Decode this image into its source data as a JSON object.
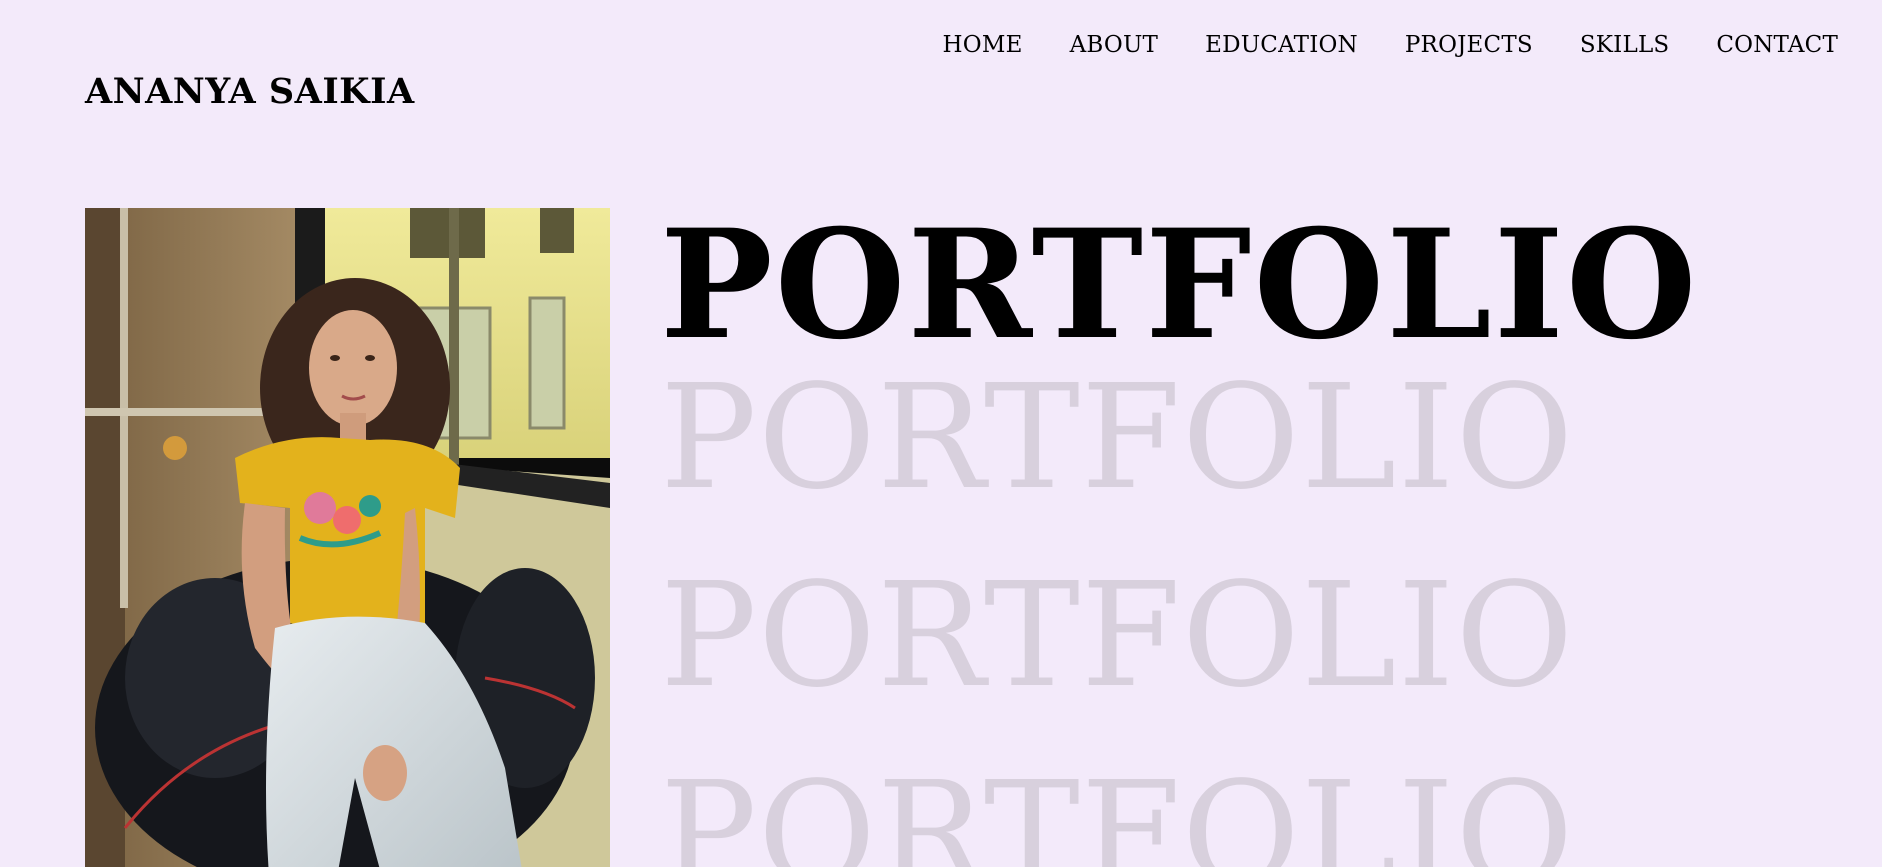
{
  "header": {
    "brand": "ANANYA SAIKIA",
    "nav": [
      "HOME",
      "ABOUT",
      "EDUCATION",
      "PROJECTS",
      "SKILLS",
      "CONTACT"
    ]
  },
  "hero": {
    "title": "PORTFOLIO",
    "echo_1": "PORTFOLIO",
    "echo_2": "PORTFOLIO",
    "echo_3": "PORTFOLIO"
  },
  "colors": {
    "background": "#f3eafa",
    "title": "#000000",
    "echo_text": "#d8d0dd"
  }
}
